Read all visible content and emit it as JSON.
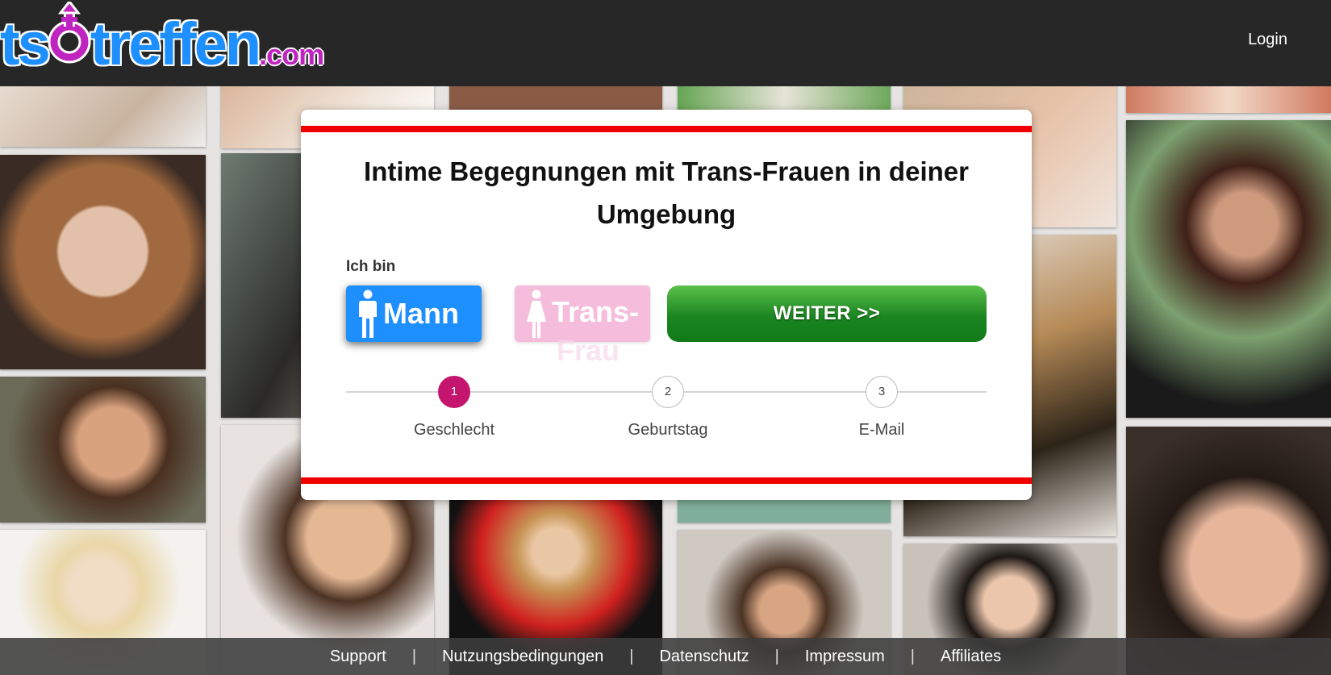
{
  "header": {
    "logo": {
      "text_ts": "ts",
      "text_treffen": "treffen",
      "text_com": ".com"
    },
    "login_label": "Login"
  },
  "card": {
    "title": "Intime Begegnungen mit Trans-Frauen in deiner Umgebung",
    "ich_bin_label": "Ich bin",
    "gender_options": [
      {
        "label": "Mann",
        "selected": true,
        "icon": "male-person-icon"
      },
      {
        "label": "Trans-",
        "overflow": "Frau",
        "selected": false,
        "icon": "female-person-icon"
      }
    ],
    "weiter_label": "WEITER >>",
    "steps": [
      {
        "number": "1",
        "label": "Geschlecht",
        "active": true
      },
      {
        "number": "2",
        "label": "Geburtstag",
        "active": false
      },
      {
        "number": "3",
        "label": "E-Mail",
        "active": false
      }
    ]
  },
  "footer": {
    "links": [
      "Support",
      "Nutzungsbedingungen",
      "Datenschutz",
      "Impressum",
      "Affiliates"
    ],
    "separator": "|"
  },
  "colors": {
    "header_bg": "#272727",
    "accent_red": "#f00000",
    "mann_blue": "#1e8fff",
    "trans_pink": "#f5bddb",
    "weiter_green": "#1a8620",
    "step_active": "#c4166e"
  }
}
